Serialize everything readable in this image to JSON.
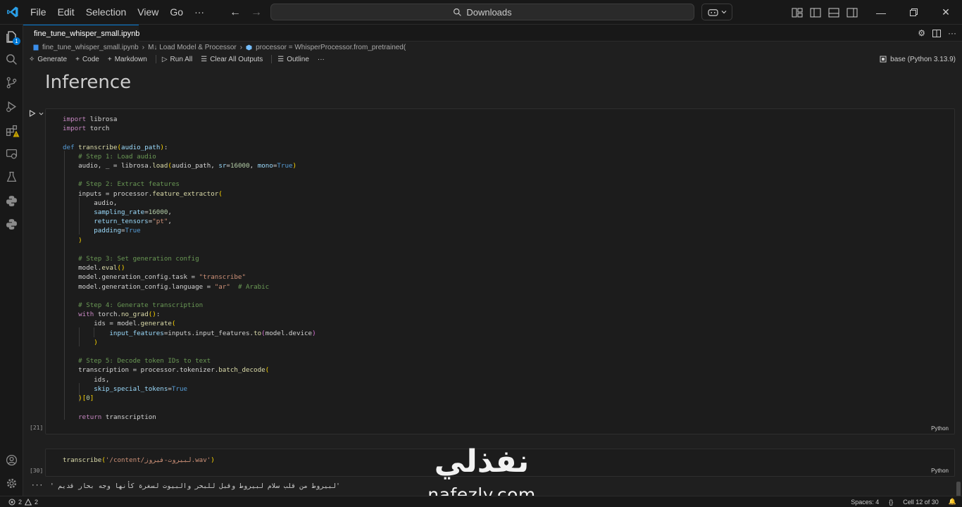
{
  "titlebar": {
    "menu": [
      "File",
      "Edit",
      "Selection",
      "View",
      "Go",
      "···"
    ],
    "search_text": "Downloads"
  },
  "activity_bar": {
    "explorer_badge": "1"
  },
  "tab": {
    "filename": "fine_tune_whisper_small.ipynb"
  },
  "breadcrumb": {
    "file": "fine_tune_whisper_small.ipynb",
    "section": "M↓ Load Model & Processor",
    "symbol": "processor = WhisperProcessor.from_pretrained("
  },
  "toolbar": {
    "generate": "Generate",
    "code": "Code",
    "markdown": "Markdown",
    "run_all": "Run All",
    "clear_outputs": "Clear All Outputs",
    "outline": "Outline",
    "more": "···",
    "kernel": "base (Python 3.13.9)"
  },
  "notebook": {
    "heading": "Inference",
    "cell1": {
      "exec_count": "[21]",
      "language": "Python",
      "lines": [
        "import librosa",
        "import torch",
        "",
        "def transcribe(audio_path):",
        "    # Step 1: Load audio",
        "    audio, _ = librosa.load(audio_path, sr=16000, mono=True)",
        "",
        "    # Step 2: Extract features",
        "    inputs = processor.feature_extractor(",
        "        audio,",
        "        sampling_rate=16000,",
        "        return_tensors=\"pt\",",
        "        padding=True",
        "    )",
        "",
        "    # Step 3: Set generation config",
        "    model.eval()",
        "    model.generation_config.task = \"transcribe\"",
        "    model.generation_config.language = \"ar\"  # Arabic",
        "",
        "    # Step 4: Generate transcription",
        "    with torch.no_grad():",
        "        ids = model.generate(",
        "            input_features=inputs.input_features.to(model.device)",
        "        )",
        "",
        "    # Step 5: Decode token IDs to text",
        "    transcription = processor.tokenizer.batch_decode(",
        "        ids,",
        "        skip_special_tokens=True",
        "    )[0]",
        "",
        "    return transcription"
      ]
    },
    "cell2": {
      "exec_count": "[30]",
      "language": "Python",
      "code": "transcribe('/content/لبيروت-فيروز.wav')"
    },
    "output": {
      "more": "···",
      "text": "' لبيروط من قلب سلام لبيروط وقبل للبحر والبيوت لسغرة كأنها وجه بحار قديم'"
    }
  },
  "watermark": {
    "arabic": "نفذلي",
    "latin": "nafezly.com"
  },
  "statusbar": {
    "errors": "2",
    "warnings": "2",
    "spaces": "Spaces: 4",
    "cell": "Cell 12 of 30"
  },
  "colors": {
    "accent": "#0078d4",
    "background": "#1f1f1f",
    "chrome": "#181818"
  }
}
